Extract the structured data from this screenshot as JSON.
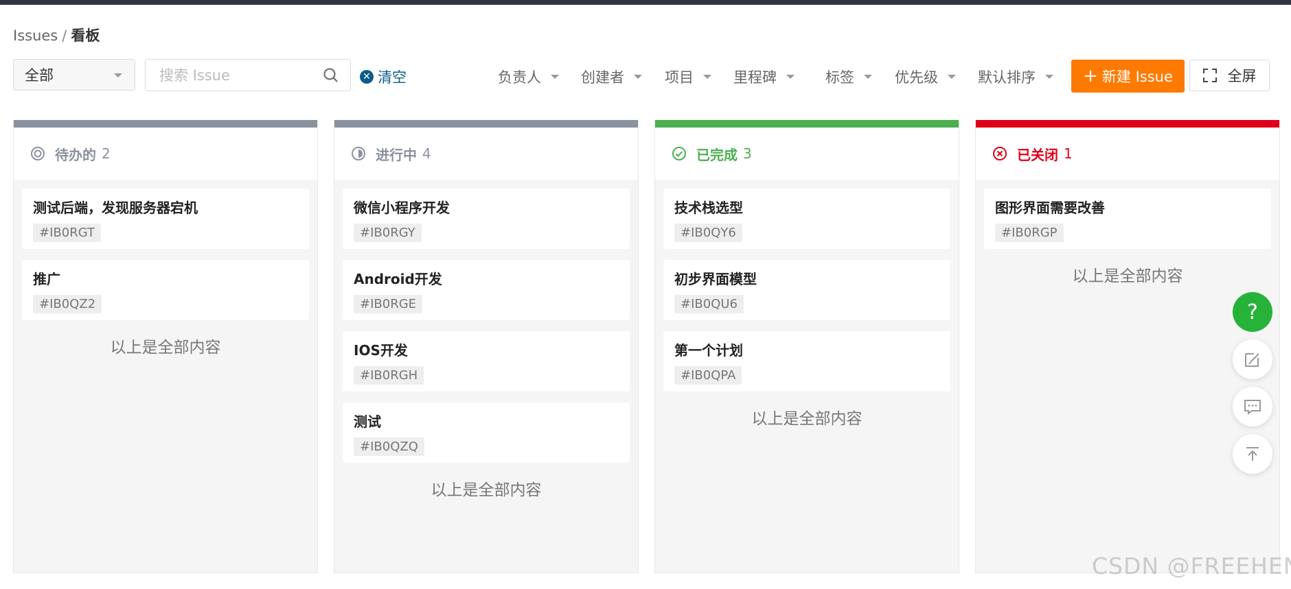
{
  "breadcrumb": {
    "root": "Issues",
    "separator": "/",
    "current": "看板"
  },
  "toolbar": {
    "status_filter": "全部",
    "search_placeholder": "搜索 Issue",
    "clear_label": "清空",
    "filters": {
      "assignee": "负责人",
      "creator": "创建者",
      "project": "项目",
      "milestone": "里程碑",
      "label": "标签",
      "priority": "优先级",
      "sort": "默认排序"
    },
    "new_issue_label": "新建 Issue",
    "new_issue_plus": "+",
    "fullscreen_label": "全屏"
  },
  "colors": {
    "accent": "#ff7a00",
    "todo": "#8a919f",
    "done": "#4caf50",
    "closed": "#e0001a",
    "help": "#27b339"
  },
  "columns": [
    {
      "title": "待办的",
      "count": "2",
      "end_text": "以上是全部内容",
      "cards": [
        {
          "title": "测试后端，发现服务器宕机",
          "id": "#IB0RGT"
        },
        {
          "title": "推广",
          "id": "#IB0QZ2"
        }
      ]
    },
    {
      "title": "进行中",
      "count": "4",
      "end_text": "以上是全部内容",
      "cards": [
        {
          "title": "微信小程序开发",
          "id": "#IB0RGY"
        },
        {
          "title": "Android开发",
          "id": "#IB0RGE"
        },
        {
          "title": "IOS开发",
          "id": "#IB0RGH"
        },
        {
          "title": "测试",
          "id": "#IB0QZQ"
        }
      ]
    },
    {
      "title": "已完成",
      "count": "3",
      "end_text": "以上是全部内容",
      "cards": [
        {
          "title": "技术栈选型",
          "id": "#IB0QY6"
        },
        {
          "title": "初步界面模型",
          "id": "#IB0QU6"
        },
        {
          "title": "第一个计划",
          "id": "#IB0QPA"
        }
      ]
    },
    {
      "title": "已关闭",
      "count": "1",
      "end_text": "以上是全部内容",
      "cards": [
        {
          "title": "图形界面需要改善",
          "id": "#IB0RGP"
        }
      ]
    }
  ],
  "float": {
    "help_label": "?"
  },
  "watermark": "CSDN @FREEHEN"
}
